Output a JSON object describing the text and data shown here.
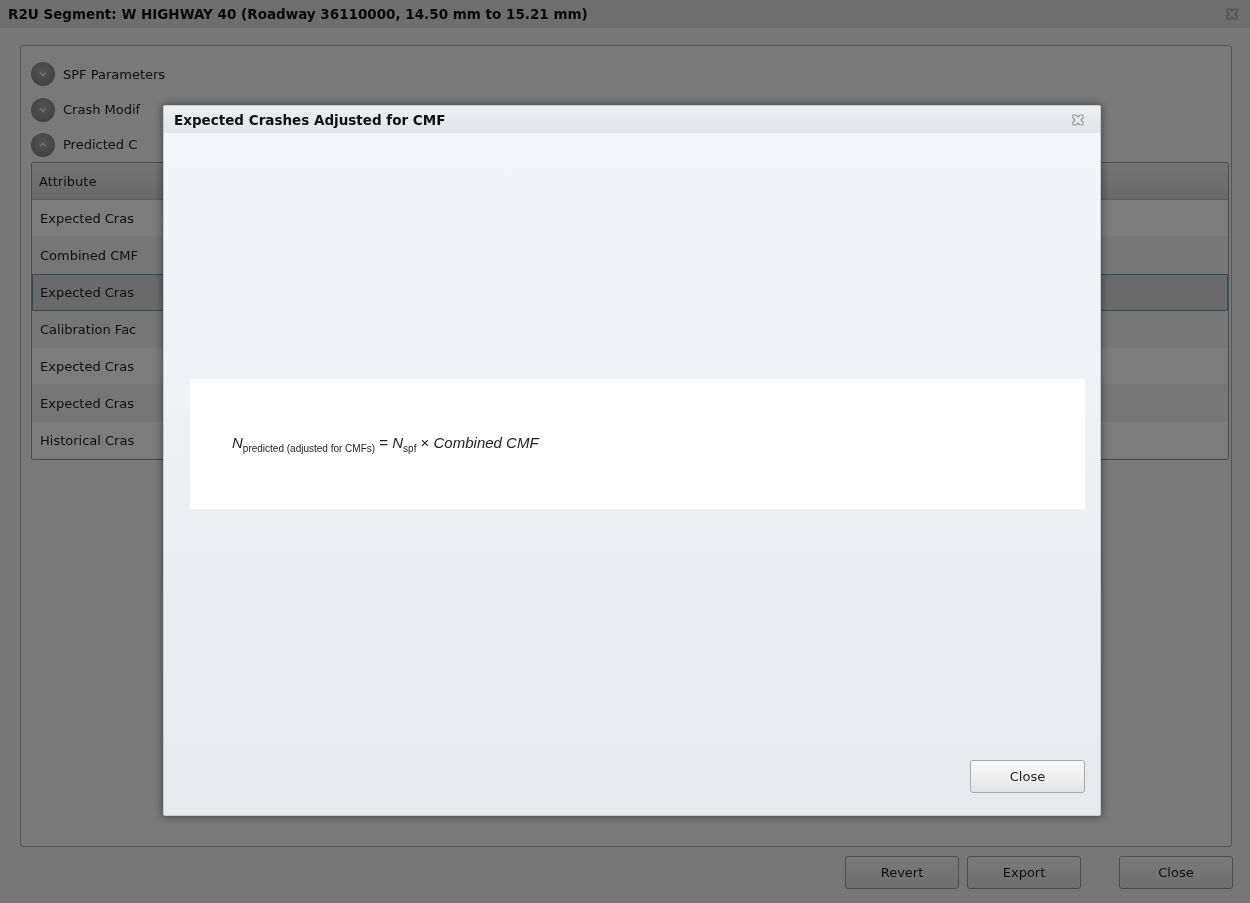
{
  "window": {
    "title": "R2U Segment: W HIGHWAY 40 (Roadway 36110000, 14.50 mm to 15.21 mm)"
  },
  "sections": [
    {
      "label": "SPF Parameters",
      "expanded": false
    },
    {
      "label": "Crash Modif",
      "expanded": false
    },
    {
      "label": "Predicted C",
      "expanded": true
    }
  ],
  "table": {
    "columns": [
      "Attribute"
    ],
    "rows": [
      {
        "cells": [
          "Expected Cras"
        ],
        "selected": false
      },
      {
        "cells": [
          "Combined CMF"
        ],
        "selected": false
      },
      {
        "cells": [
          "Expected Cras"
        ],
        "selected": true
      },
      {
        "cells": [
          "Calibration Fac"
        ],
        "selected": false
      },
      {
        "cells": [
          "Expected Cras"
        ],
        "selected": false
      },
      {
        "cells": [
          "Expected Cras"
        ],
        "selected": false
      },
      {
        "cells": [
          "Historical Cras"
        ],
        "selected": false
      }
    ]
  },
  "buttons": [
    "Revert",
    "Export",
    "Close"
  ],
  "dialog": {
    "title": "Expected Crashes Adjusted for CMF",
    "formula": "*N*$_{predicted (adjusted for CMFs)}$ = *N*$_{spf}$ × *Combined CMF*",
    "buttons": [
      "Close"
    ]
  }
}
